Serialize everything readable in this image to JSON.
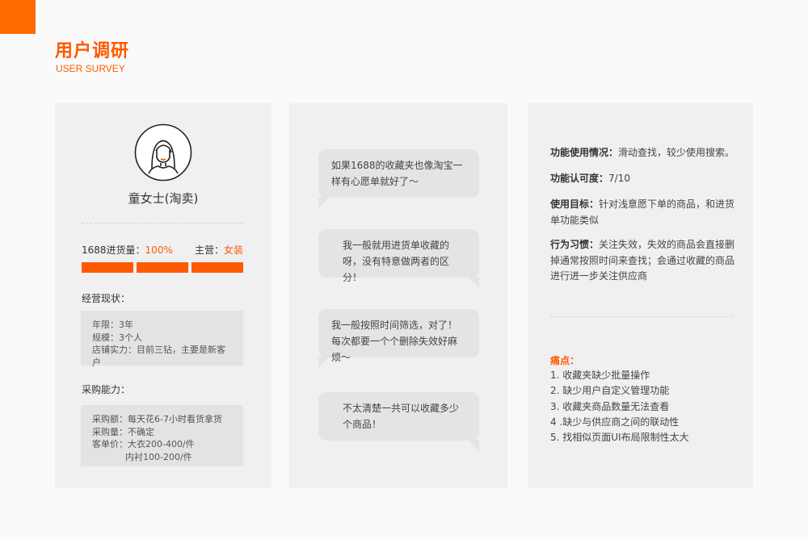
{
  "header": {
    "title": "用户调研",
    "subtitle": "USER SURVEY"
  },
  "persona": {
    "name": "童女士(淘卖)",
    "volume_label": "1688进货量：",
    "volume_value": "100%",
    "volume_fraction": 1.0,
    "category_label": "主营：",
    "category_value": "女装",
    "status_title": "经营现状：",
    "status_lines": [
      "年限：3年",
      "规模：3个人",
      "店铺实力：目前三钻，主要是新客户"
    ],
    "purchase_title": "采购能力：",
    "purchase_lines": [
      "采购额：每天花6-7小时看货拿货",
      "采购量：不确定",
      "客单价：大衣200-400/件"
    ],
    "purchase_line_cont": "内衬100-200/件"
  },
  "quotes": [
    {
      "text": "如果1688的收藏夹也像淘宝一样有心愿单就好了～",
      "side": "left"
    },
    {
      "text": "我一般就用进货单收藏的呀，没有特意做两者的区分！",
      "side": "right"
    },
    {
      "text": "我一般按照时间筛选，对了！每次都要一个个删除失效好麻烦～",
      "side": "left"
    },
    {
      "text": "不太清楚一共可以收藏多少个商品！",
      "side": "right"
    }
  ],
  "findings": {
    "usage_label": "功能使用情况：",
    "usage_value": "滑动查找，较少使用搜索。",
    "rating_label": "功能认可度：",
    "rating_value": "7/10",
    "goal_label": "使用目标：",
    "goal_value": "针对浅意愿下单的商品，和进货单功能类似",
    "habit_label": "行为习惯：",
    "habit_value": "关注失效，失效的商品会直接删掉通常按照时间来查找；会通过收藏的商品进行进一步关注供应商",
    "pain_title": "痛点：",
    "pain_points": [
      "1. 收藏夹缺少批量操作",
      "2. 缺少用户自定义管理功能",
      "3. 收藏夹商品数量无法查看",
      "4 .缺少与供应商之间的联动性",
      "5. 找相似页面UI布局限制性太大"
    ]
  },
  "colors": {
    "accent": "#ff5a00",
    "card_bg": "#f0f0f2",
    "box_bg": "#e3e3e5"
  }
}
